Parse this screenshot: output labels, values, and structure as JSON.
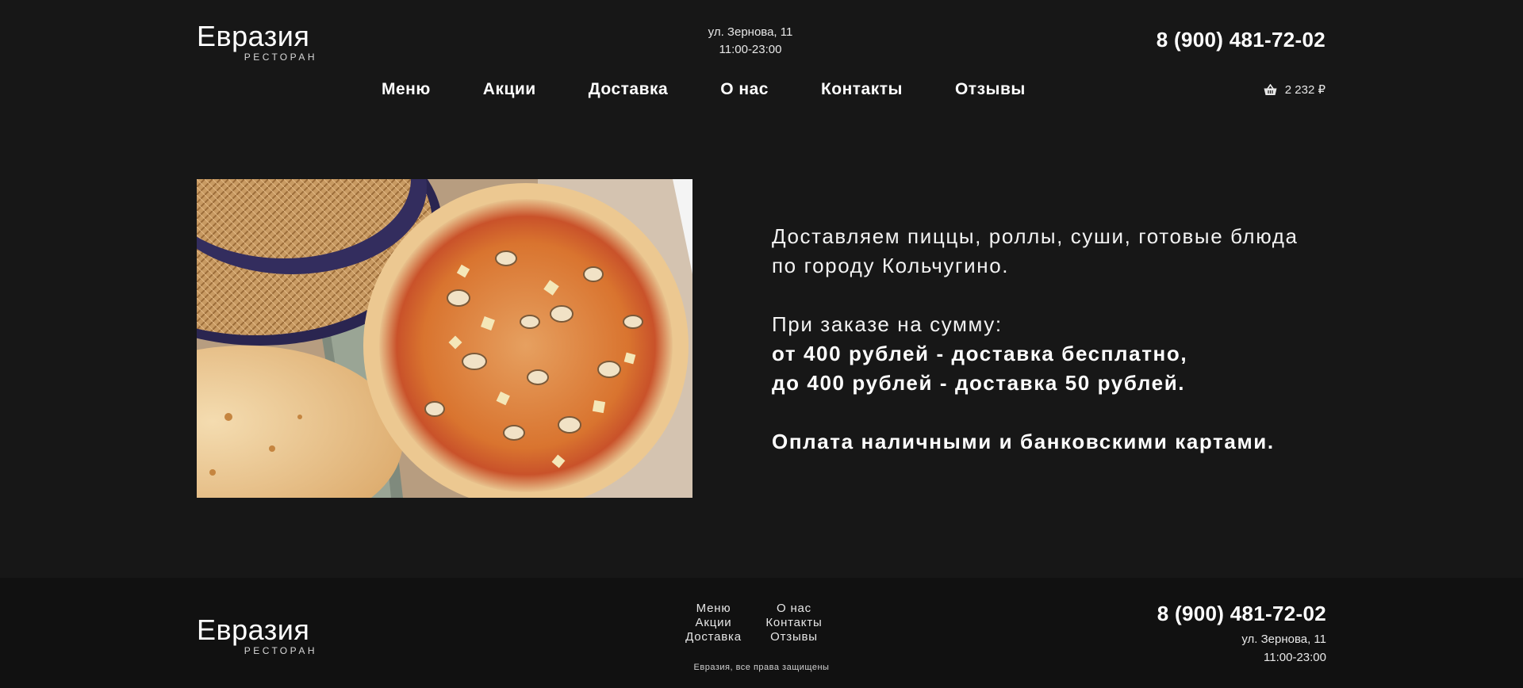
{
  "brand": {
    "name": "Евразия",
    "tagline": "РЕСТОРАН"
  },
  "header": {
    "address": "ул. Зернова, 11",
    "hours": "11:00-23:00",
    "phone": "8 (900) 481-72-02",
    "nav": [
      "Меню",
      "Акции",
      "Доставка",
      "О нас",
      "Контакты",
      "Отзывы"
    ],
    "cart_total": "2 232 ₽",
    "cart_icon": "basket-icon"
  },
  "hero": {
    "image_alt": "pizza-photo",
    "line1": "Доставляем пиццы, роллы, суши, готовые блюда",
    "line2": "по городу Кольчугино.",
    "order_intro": "При заказе на сумму:",
    "free_delivery": "от 400 рублей - доставка бесплатно,",
    "paid_delivery": "до 400 рублей - доставка 50 рублей.",
    "payment": "Оплата наличными и банковскими картами."
  },
  "footer": {
    "nav_col1": [
      "Меню",
      "Акции",
      "Доставка"
    ],
    "nav_col2": [
      "О нас",
      "Контакты",
      "Отзывы"
    ],
    "copyright": "Евразия, все права защищены",
    "phone": "8 (900) 481-72-02",
    "address": "ул. Зернова, 11",
    "hours": "11:00-23:00"
  },
  "colors": {
    "background": "#171717",
    "footer_background": "#111111",
    "text": "#ffffff"
  }
}
